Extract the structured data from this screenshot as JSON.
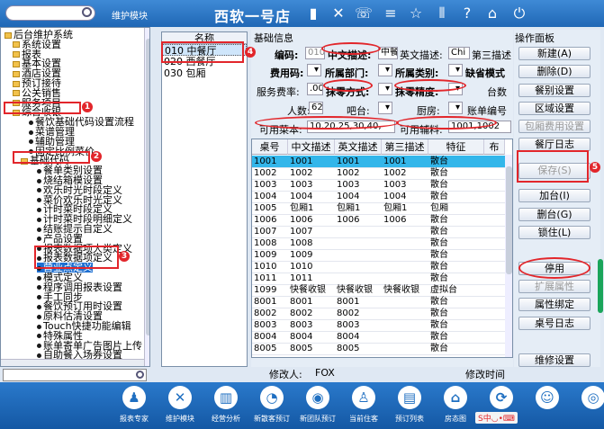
{
  "topbar": {
    "module_label": "维护模块",
    "app_title": "西软一号店",
    "icons": [
      "signal-icon",
      "tools-icon",
      "phone-icon",
      "menu-icon",
      "star-icon",
      "columns-icon",
      "help-icon",
      "home-icon",
      "power-icon"
    ]
  },
  "tree": {
    "items": [
      {
        "label": "后台维护系统",
        "indent": 0,
        "kind": "folder"
      },
      {
        "label": "系统设置",
        "indent": 1,
        "kind": "folder"
      },
      {
        "label": "报表",
        "indent": 1,
        "kind": "folder"
      },
      {
        "label": "基本设置",
        "indent": 1,
        "kind": "folder"
      },
      {
        "label": "酒店设置",
        "indent": 1,
        "kind": "folder"
      },
      {
        "label": "预订接待",
        "indent": 1,
        "kind": "folder"
      },
      {
        "label": "公关销售",
        "indent": 1,
        "kind": "folder"
      },
      {
        "label": "服务项目",
        "indent": 1,
        "kind": "folder"
      },
      {
        "label": "综合收银",
        "indent": 1,
        "kind": "folder"
      },
      {
        "label": "餐饮基础代码设置流程",
        "indent": 3,
        "kind": "dot"
      },
      {
        "label": "菜谱管理",
        "indent": 3,
        "kind": "dot"
      },
      {
        "label": "辅助管理",
        "indent": 3,
        "kind": "dot"
      },
      {
        "label": "固定比例菜价",
        "indent": 3,
        "kind": "dot"
      },
      {
        "label": "基础代码",
        "indent": 2,
        "kind": "folder"
      },
      {
        "label": "餐单类别设置",
        "indent": 4,
        "kind": "dot"
      },
      {
        "label": "烧结箱模设置",
        "indent": 4,
        "kind": "dot"
      },
      {
        "label": "欢乐时光时段定义",
        "indent": 4,
        "kind": "dot"
      },
      {
        "label": "菜价欢乐时光定义",
        "indent": 4,
        "kind": "dot"
      },
      {
        "label": "计时菜时段定义",
        "indent": 4,
        "kind": "dot"
      },
      {
        "label": "计时菜时段明细定义",
        "indent": 4,
        "kind": "dot"
      },
      {
        "label": "结账提示自定义",
        "indent": 4,
        "kind": "dot"
      },
      {
        "label": "产品设置",
        "indent": 4,
        "kind": "dot"
      },
      {
        "label": "报表数据项大类定义",
        "indent": 4,
        "kind": "dot"
      },
      {
        "label": "报表数据项定义",
        "indent": 4,
        "kind": "dot"
      },
      {
        "label": "营业点定义",
        "indent": 4,
        "kind": "dot",
        "selected": true
      },
      {
        "label": "模式定义",
        "indent": 4,
        "kind": "dot"
      },
      {
        "label": "程序调用报表设置",
        "indent": 4,
        "kind": "dot"
      },
      {
        "label": "手工同步",
        "indent": 4,
        "kind": "dot"
      },
      {
        "label": "餐饮预订用时设置",
        "indent": 4,
        "kind": "dot"
      },
      {
        "label": "原料估清设置",
        "indent": 4,
        "kind": "dot"
      },
      {
        "label": "Touch快捷功能编辑",
        "indent": 4,
        "kind": "dot"
      },
      {
        "label": "特殊属性",
        "indent": 4,
        "kind": "dot"
      },
      {
        "label": "账单寄单广告图片上传",
        "indent": 4,
        "kind": "dot"
      },
      {
        "label": "自助餐入场券设置",
        "indent": 4,
        "kind": "dot"
      }
    ]
  },
  "namelist": {
    "header": "名称",
    "rows": [
      {
        "label": "010 中餐厅",
        "selected": true
      },
      {
        "label": "020 西餐厅"
      },
      {
        "label": "030 包厢"
      }
    ]
  },
  "info": {
    "section_title": "基础信息",
    "code_label": "编码:",
    "code_value": "010",
    "cn_desc_label": "中文描述:",
    "cn_desc_value": "中餐",
    "en_desc_label": "英文描述:",
    "en_desc_value": "Chi",
    "third_desc_label": "第三描述",
    "fee_code_label": "费用码:",
    "dept_label": "所属部门:",
    "cat_label": "所属类别:",
    "default_mode_label": "缺省模式",
    "service_rate_label": "服务费率:",
    "service_rate_value": ".00",
    "rounding_label": "抹零方式:",
    "precision_label": "抹零精度:",
    "tables_label": "台数",
    "people_label": "人数:",
    "people_value": "62",
    "bar_label": "吧台:",
    "kitchen_label": "厨房:",
    "acct_label": "账单编号",
    "menus_label": "可用菜本:",
    "menus_value": "10,20,25,30,40,",
    "aux_label": "可用辅料:",
    "aux_value": "1001,1002",
    "modifier_label": "修改人:",
    "modifier_value": "FOX",
    "modtime_label": "修改时间"
  },
  "grid": {
    "headers": [
      "桌号",
      "中文描述",
      "英文描述",
      "第三描述",
      "特征",
      "布"
    ],
    "rows": [
      [
        "1001",
        "1001",
        "1001",
        "1001",
        "散台"
      ],
      [
        "1002",
        "1002",
        "1002",
        "1002",
        "散台"
      ],
      [
        "1003",
        "1003",
        "1003",
        "1003",
        "散台"
      ],
      [
        "1004",
        "1004",
        "1004",
        "1004",
        "散台"
      ],
      [
        "1005",
        "包厢1",
        "包厢1",
        "包厢1",
        "包厢"
      ],
      [
        "1006",
        "1006",
        "1006",
        "1006",
        "散台"
      ],
      [
        "1007",
        "1007",
        "",
        "",
        "散台"
      ],
      [
        "1008",
        "1008",
        "",
        "",
        "散台"
      ],
      [
        "1009",
        "1009",
        "",
        "",
        "散台"
      ],
      [
        "1010",
        "1010",
        "",
        "",
        "散台"
      ],
      [
        "1011",
        "1011",
        "",
        "",
        "散台"
      ],
      [
        "1099",
        "快餐收银",
        "快餐收银",
        "快餐收银",
        "虚拟台"
      ],
      [
        "8001",
        "8001",
        "8001",
        "",
        "散台"
      ],
      [
        "8002",
        "8002",
        "8002",
        "",
        "散台"
      ],
      [
        "8003",
        "8003",
        "8003",
        "",
        "散台"
      ],
      [
        "8004",
        "8004",
        "8004",
        "",
        "散台"
      ],
      [
        "8005",
        "8005",
        "8005",
        "",
        "散台"
      ]
    ]
  },
  "panel": {
    "title": "操作面板",
    "buttons": [
      {
        "label": "新建(A)",
        "enabled": true
      },
      {
        "label": "删除(D)",
        "enabled": true
      },
      {
        "label": "餐别设置",
        "enabled": true
      },
      {
        "label": "区域设置",
        "enabled": true
      },
      {
        "label": "包厢费用设置",
        "enabled": false
      },
      {
        "label": "餐厅日志",
        "enabled": true
      },
      {
        "label": "保存(S)",
        "enabled": false
      },
      {
        "label": "加台(I)",
        "enabled": true
      },
      {
        "label": "删台(G)",
        "enabled": true
      },
      {
        "label": "锁住(L)",
        "enabled": true
      },
      {
        "label": "停用",
        "enabled": true
      },
      {
        "label": "扩展属性",
        "enabled": false
      },
      {
        "label": "属性绑定",
        "enabled": true
      },
      {
        "label": "桌号日志",
        "enabled": true
      },
      {
        "label": "维修设置",
        "enabled": true
      }
    ]
  },
  "taskbar": {
    "items": [
      {
        "label": "报表专家",
        "icon": "person-icon"
      },
      {
        "label": "维护模块",
        "icon": "tools-icon"
      },
      {
        "label": "经营分析",
        "icon": "chart-icon"
      },
      {
        "label": "新散客预订",
        "icon": "booking-icon"
      },
      {
        "label": "新团队预订",
        "icon": "group-icon"
      },
      {
        "label": "当前住客",
        "icon": "guest-icon"
      },
      {
        "label": "预订列表",
        "icon": "list-icon"
      },
      {
        "label": "房态图",
        "icon": "room-icon"
      },
      {
        "label": "",
        "icon": "refresh-icon"
      },
      {
        "label": "",
        "icon": "people-icon"
      },
      {
        "label": "",
        "icon": "eye-icon"
      }
    ]
  },
  "annotations": [
    "1",
    "2",
    "3",
    "4",
    "5"
  ],
  "colors": {
    "accent": "#1f67b5",
    "highlight_row": "#33b6ea",
    "annotation": "#e2262b"
  }
}
